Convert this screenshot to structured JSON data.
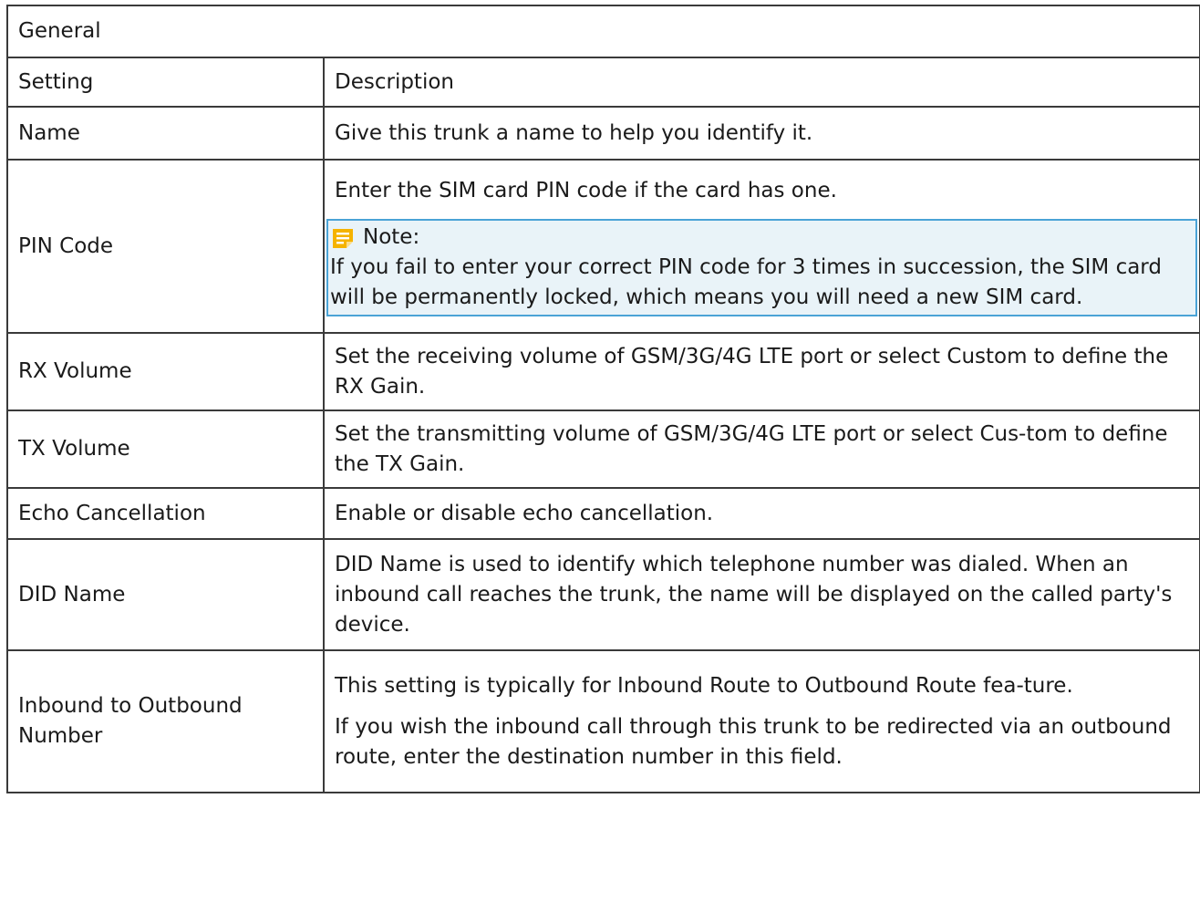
{
  "table": {
    "section_title": "General",
    "headers": {
      "setting": "Setting",
      "description": "Description"
    },
    "rows": {
      "name": {
        "setting": "Name",
        "description": "Give this trunk a name to help you identify it."
      },
      "pin": {
        "setting": "PIN Code",
        "description": "Enter the SIM card PIN code if the card has one.",
        "note_label": "Note:",
        "note_text": "If you fail to enter your correct PIN code for 3 times in succession, the SIM card will be permanently locked, which means you will need a new SIM card."
      },
      "rx": {
        "setting": "RX Volume",
        "description": "Set the receiving volume of GSM/3G/4G LTE port or select Custom to define the RX Gain."
      },
      "tx": {
        "setting": "TX Volume",
        "description": "Set the transmitting volume of GSM/3G/4G LTE port or select Cus-tom to define the TX Gain."
      },
      "echo": {
        "setting": "Echo Cancellation",
        "description": "Enable or disable echo cancellation."
      },
      "did": {
        "setting": "DID Name",
        "description": "DID Name is used to identify which telephone number was dialed. When an inbound call reaches the trunk, the name will be displayed on the called party's device."
      },
      "inbound": {
        "setting": "Inbound to Outbound Number",
        "description_1": "This setting is typically for Inbound Route to Outbound Route fea-ture.",
        "description_2": "If you wish the inbound call through this trunk to be redirected via an outbound route, enter the destination number in this field."
      }
    }
  },
  "icons": {
    "note": "note-icon"
  },
  "colors": {
    "note_border": "#4aa3d6",
    "note_background": "#e9f3f8",
    "note_icon": "#f5b300"
  }
}
